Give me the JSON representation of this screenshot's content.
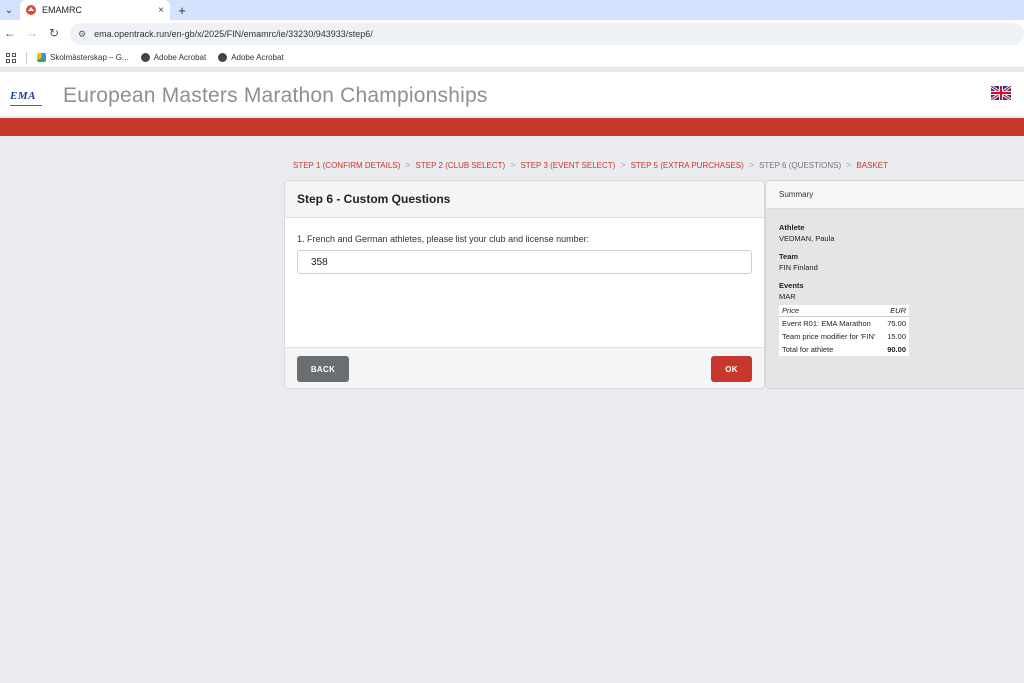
{
  "browser": {
    "tab_title": "EMAMRC",
    "tab_close": "×",
    "new_tab": "+",
    "url": "ema.opentrack.run/en-gb/x/2025/FIN/emamrc/ie/33230/943933/step6/",
    "bookmarks": [
      {
        "label": "Skolmästerskap – G..."
      },
      {
        "label": "Adobe Acrobat"
      },
      {
        "label": "Adobe Acrobat"
      }
    ]
  },
  "header": {
    "logo_text": "EMA",
    "title": "European Masters Marathon Championships"
  },
  "breadcrumbs": [
    {
      "label": "STEP 1 (CONFIRM DETAILS)",
      "current": false
    },
    {
      "label": "STEP 2 (CLUB SELECT)",
      "current": false
    },
    {
      "label": "STEP 3 (EVENT SELECT)",
      "current": false
    },
    {
      "label": "STEP 5 (EXTRA PURCHASES)",
      "current": false
    },
    {
      "label": "STEP 6 (QUESTIONS)",
      "current": true
    },
    {
      "label": "BASKET",
      "current": false
    }
  ],
  "form": {
    "heading": "Step 6 - Custom Questions",
    "question_label": "1. French and German athletes, please list your club and license number:",
    "answer_value": "358",
    "back_label": "BACK",
    "ok_label": "OK"
  },
  "summary": {
    "heading": "Summary",
    "athlete_label": "Athlete",
    "athlete_value": "VEDMAN, Paula",
    "team_label": "Team",
    "team_value": "FIN Finland",
    "events_label": "Events",
    "events_value": "MAR",
    "price_header": "Price",
    "currency_header": "EUR",
    "rows": [
      {
        "item": "Event R01: EMA Marathon",
        "amount": "75.00"
      },
      {
        "item": "Team price modifier for 'FIN'",
        "amount": "15.00"
      }
    ],
    "total_label": "Total for athlete",
    "total_value": "90.00"
  },
  "colors": {
    "brand_red": "#c8372d",
    "title_grey": "#8f8f8f"
  }
}
